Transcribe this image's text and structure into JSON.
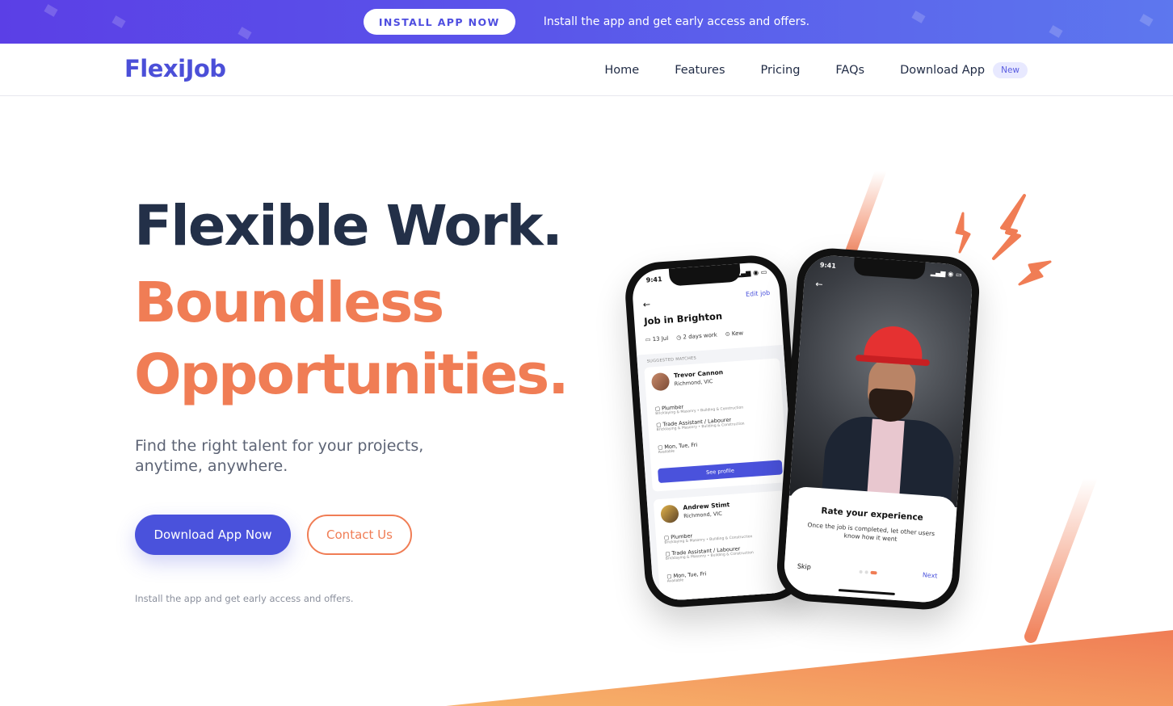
{
  "promo": {
    "button_label": "INSTALL APP NOW",
    "text": "Install the app and get early access and offers."
  },
  "nav": {
    "logo": "FlexiJob",
    "links": [
      "Home",
      "Features",
      "Pricing",
      "FAQs",
      "Download App"
    ],
    "badge": "New"
  },
  "hero": {
    "line1": "Flexible Work.",
    "line2": "Boundless",
    "line3": "Opportunities.",
    "subtitle": "Find the right talent for your projects, anytime, anywhere.",
    "primary_cta": "Download App Now",
    "secondary_cta": "Contact Us",
    "note": "Install the app and get early access and offers."
  },
  "phone1": {
    "time": "9:41",
    "edit": "Edit job",
    "title": "Job in Brighton",
    "meta": [
      "13 Jul",
      "2 days work",
      "Kew"
    ],
    "section_label": "SUGGESTED MATCHES",
    "candidates": [
      {
        "name": "Trevor Cannon",
        "location": "Richmond, VIC",
        "roles": [
          {
            "title": "Plumber",
            "tags": "Bricklaying & Masonry • Building & Construction"
          },
          {
            "title": "Trade Assistant / Labourer",
            "tags": "Bricklaying & Masonry • Building & Construction"
          }
        ],
        "availability": "Mon, Tue, Fri",
        "availability_note": "Available",
        "button": "See profile"
      },
      {
        "name": "Andrew Stimt",
        "location": "Richmond, VIC",
        "roles": [
          {
            "title": "Plumber",
            "tags": "Bricklaying & Masonry • Building & Construction"
          },
          {
            "title": "Trade Assistant / Labourer",
            "tags": "Bricklaying & Masonry • Building & Construction"
          }
        ],
        "availability": "Mon, Tue, Fri",
        "availability_note": "Available"
      }
    ]
  },
  "phone2": {
    "time": "9:41",
    "rate_title": "Rate your experience",
    "rate_desc": "Once the job is completed, let other users know how it went",
    "skip": "Skip",
    "next": "Next"
  },
  "colors": {
    "brand": "#4a52dc",
    "accent": "#f07d55",
    "heading": "#233048"
  }
}
